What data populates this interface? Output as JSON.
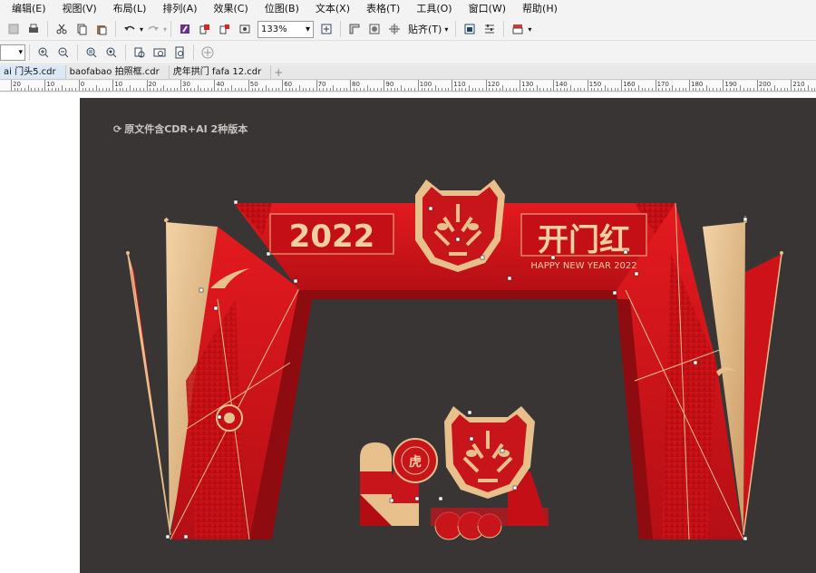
{
  "menu": {
    "items": [
      "编辑(E)",
      "视图(V)",
      "布局(L)",
      "排列(A)",
      "效果(C)",
      "位图(B)",
      "文本(X)",
      "表格(T)",
      "工具(O)",
      "窗口(W)",
      "帮助(H)"
    ]
  },
  "toolbar": {
    "zoom_value": "133%",
    "snap_label": "贴齐(T)"
  },
  "tabs": [
    {
      "label": "ai 门头5.cdr",
      "active": true
    },
    {
      "label": "baofabao 拍照框.cdr",
      "active": false
    },
    {
      "label": "虎年拱门 fafa 12.cdr",
      "active": false
    }
  ],
  "ruler": {
    "labels": [
      "20",
      "10",
      "0",
      "10",
      "20",
      "30",
      "40",
      "50",
      "60",
      "70",
      "80",
      "90",
      "100",
      "110",
      "120",
      "130",
      "140",
      "150",
      "160",
      "170",
      "180",
      "190",
      "200",
      "210"
    ]
  },
  "canvas": {
    "watermark": "原文件含CDR+AI 2种版本",
    "arch_year": "2022",
    "arch_title": "开门红",
    "arch_subtitle": "HAPPY NEW YEAR 2022",
    "tiger_seal": "虎",
    "colors": {
      "background": "#3a3535",
      "red": "#d8141a",
      "dark_red": "#8e0b10",
      "gold": "#e8c08c"
    }
  }
}
